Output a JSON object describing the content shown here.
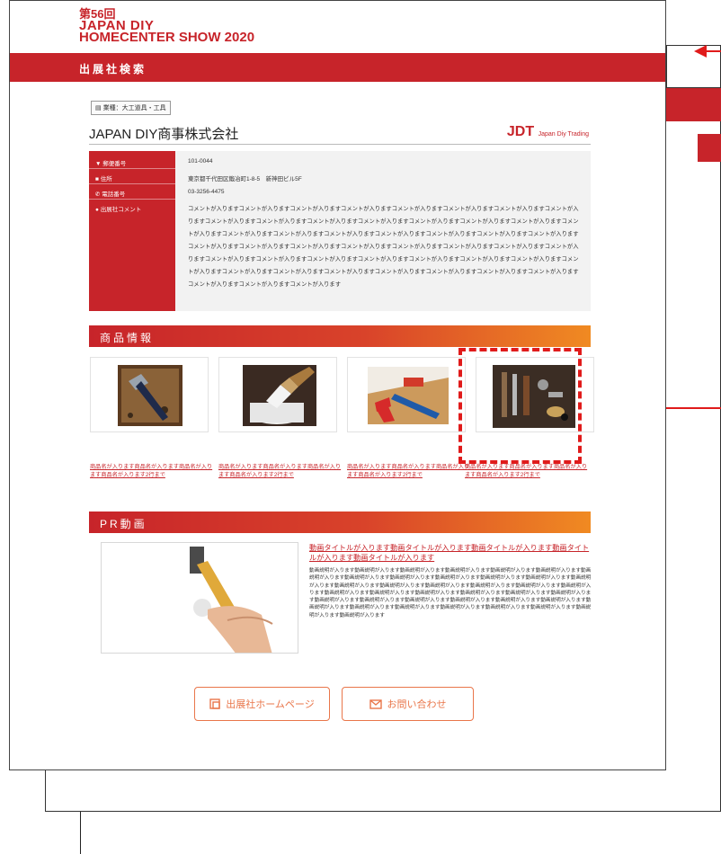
{
  "event": {
    "logo_line1": "第56回",
    "logo_line2": "JAPAN DIY",
    "logo_line3": "HOMECENTER SHOW 2020"
  },
  "header": {
    "title": "出展社検索"
  },
  "company": {
    "category": "業種：大工道具・工具",
    "name": "JAPAN DIY商事株式会社",
    "logo_main": "JDT",
    "logo_sub": "Japan Diy Trading"
  },
  "info": {
    "rows": [
      {
        "label": "郵便番号",
        "value": "101-0044"
      },
      {
        "label": "住所",
        "value": "東京都千代田区鍛冶町1-8-5　新神田ビル5F"
      },
      {
        "label": "電話番号",
        "value": "03-3256-4475"
      },
      {
        "label": "出展社コメント",
        "value": ""
      }
    ],
    "comment": "コメントが入りますコメントが入りますコメントが入りますコメントが入りますコメントが入りますコメントが入りますコメントが入りますコメントが入りますコメントが入りますコメントが入りますコメントが入りますコメントが入りますコメントが入りますコメントが入りますコメントが入りますコメントが入りますコメントが入りますコメントが入りますコメントが入りますコメントが入りますコメントが入りますコメントが入りますコメントが入りますコメントが入りますコメントが入りますコメントが入りますコメントが入りますコメントが入りますコメントが入りますコメントが入りますコメントが入りますコメントが入りますコメントが入りますコメントが入りますコメントが入りますコメントが入りますコメントが入りますコメントが入りますコメントが入りますコメントが入りますコメントが入りますコメントが入りますコメントが入りますコメントが入りますコメントが入りますコメントが入りますコメントが入りますコメントが入りますコメントが入ります"
  },
  "products": {
    "heading": "商品情報",
    "items": [
      {
        "caption": "商品名が入ります商品名が入ります商品名が入ります商品名が入ります2行まで"
      },
      {
        "caption": "商品名が入ります商品名が入ります商品名が入ります商品名が入ります2行まで"
      },
      {
        "caption": "商品名が入ります商品名が入ります商品名が入ります商品名が入ります2行まで"
      },
      {
        "caption": "商品名が入ります商品名が入ります商品名が入ります商品名が入ります2行まで"
      }
    ]
  },
  "pr": {
    "heading": "PR動画",
    "title": "動画タイトルが入ります動画タイトルが入ります動画タイトルが入ります動画タイトルが入ります動画タイトルが入ります",
    "description": "動画説明が入ります動画説明が入ります動画説明が入ります動画説明が入ります動画説明が入ります動画説明が入ります動画説明が入ります動画説明が入ります動画説明が入ります動画説明が入ります動画説明が入ります動画説明が入ります動画説明が入ります動画説明が入ります動画説明が入ります動画説明が入ります動画説明が入ります動画説明が入ります動画説明が入ります動画説明が入ります動画説明が入ります動画説明が入ります動画説明が入ります動画説明が入ります動画説明が入ります動画説明が入ります動画説明が入ります動画説明が入ります動画説明が入ります動画説明が入ります動画説明が入ります動画説明が入ります動画説明が入ります動画説明が入ります動画説明が入ります動画説明が入ります動画説明が入ります動画説明が入ります動画説明が入ります"
  },
  "buttons": {
    "homepage": "出展社ホームページ",
    "contact": "お問い合わせ"
  },
  "colors": {
    "brand": "#c7242a",
    "accent": "#f08a22",
    "button": "#e9764a",
    "highlight": "#e01b1b"
  }
}
